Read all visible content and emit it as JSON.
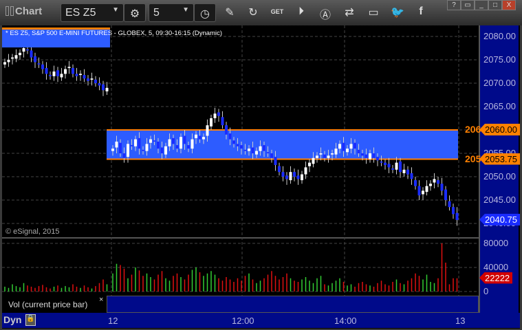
{
  "window": {
    "title": "Chart",
    "symbol": "ES Z5",
    "interval": "5",
    "buttons": [
      "?",
      "▭",
      "_",
      "□",
      "X"
    ]
  },
  "toolbar_icons": [
    "pencil-icon",
    "refresh-icon",
    "get-icon",
    "play-icon",
    "alert-icon",
    "link-icon",
    "comment-icon",
    "twitter-icon",
    "facebook-icon"
  ],
  "chart": {
    "header": "* ES Z5, S&P 500 E-MINI FUTURES - GLOBEX, 5, 09:30-16:15 (Dynamic)",
    "copyright": "© eSignal, 2015",
    "price_ticks": [
      "2080.00",
      "2075.00",
      "2070.00",
      "2065.00",
      "2060.00",
      "2055.00",
      "2050.00",
      "2045.00",
      "2040.00"
    ],
    "volume_ticks": [
      "80000",
      "40000",
      "0"
    ],
    "time_ticks": [
      "12",
      "12:00",
      "14:00",
      "13"
    ],
    "zone": {
      "upper_label": "206",
      "lower_label": "205",
      "upper": "2060.00",
      "lower": "2053.75"
    },
    "last_price": "2040.75",
    "last_volume": "22222",
    "volume_study": "Vol (current price bar)",
    "close_button": "×",
    "mode": "Dyn"
  },
  "colors": {
    "up": "#ffffff",
    "down": "#1a2cff",
    "zone": "#2d5cff",
    "zone_line": "#ff8000",
    "vol_up": "#33cc33",
    "vol_down": "#e01010"
  },
  "chart_data": {
    "type": "candlestick",
    "ylim": [
      2038,
      2083
    ],
    "closes": [
      2074.5,
      2075,
      2075.5,
      2076,
      2076.5,
      2077.5,
      2077,
      2075.5,
      2074.5,
      2074,
      2073,
      2072,
      2071.5,
      2072.5,
      2071.5,
      2072,
      2073,
      2073.5,
      2072,
      2071.5,
      2072,
      2071,
      2070.5,
      2071,
      2070,
      2069.5,
      2068.5,
      2069,
      2056,
      2057.5,
      2055,
      2054,
      2057,
      2056.5,
      2058,
      2056,
      2055.5,
      2057,
      2058,
      2057.5,
      2056,
      2055,
      2056.5,
      2058,
      2057,
      2056,
      2058.5,
      2057,
      2056,
      2058,
      2059,
      2058,
      2058.5,
      2061,
      2062.5,
      2063.5,
      2063,
      2061,
      2059,
      2058,
      2057,
      2056.5,
      2056,
      2055.5,
      2056,
      2055,
      2055.5,
      2056.5,
      2055.5,
      2055,
      2054,
      2052.5,
      2051,
      2050,
      2049.5,
      2051,
      2050,
      2049.5,
      2050.5,
      2052,
      2053,
      2054,
      2054.5,
      2055,
      2054,
      2054.5,
      2055,
      2056,
      2057,
      2055.5,
      2056,
      2057,
      2056,
      2055,
      2054.5,
      2054,
      2055,
      2054,
      2053.5,
      2053,
      2052.5,
      2052,
      2051.5,
      2053,
      2051,
      2051.5,
      2050.5,
      2049.5,
      2048,
      2046,
      2047,
      2048,
      2048.5,
      2049.5,
      2048.5,
      2047,
      2045,
      2043.5,
      2042,
      2040.75
    ],
    "volume_thousands": [
      8,
      6,
      12,
      9,
      7,
      14,
      10,
      8,
      6,
      9,
      11,
      7,
      5,
      8,
      10,
      6,
      9,
      7,
      12,
      8,
      6,
      10,
      7,
      5,
      9,
      14,
      20,
      12,
      30,
      46,
      44,
      38,
      22,
      28,
      40,
      35,
      26,
      30,
      24,
      20,
      28,
      34,
      22,
      18,
      26,
      30,
      24,
      20,
      28,
      36,
      40,
      32,
      26,
      30,
      34,
      28,
      22,
      18,
      24,
      20,
      16,
      22,
      18,
      26,
      30,
      20,
      14,
      18,
      22,
      28,
      34,
      26,
      20,
      24,
      30,
      22,
      18,
      16,
      20,
      24,
      18,
      14,
      22,
      26,
      12,
      10,
      14,
      18,
      22,
      16,
      10,
      12,
      8,
      14,
      16,
      12,
      10,
      8,
      14,
      18,
      12,
      10,
      16,
      20,
      14,
      12,
      18,
      22,
      30,
      26,
      20,
      28,
      16,
      14,
      22,
      80,
      48,
      12,
      22,
      22
    ]
  }
}
